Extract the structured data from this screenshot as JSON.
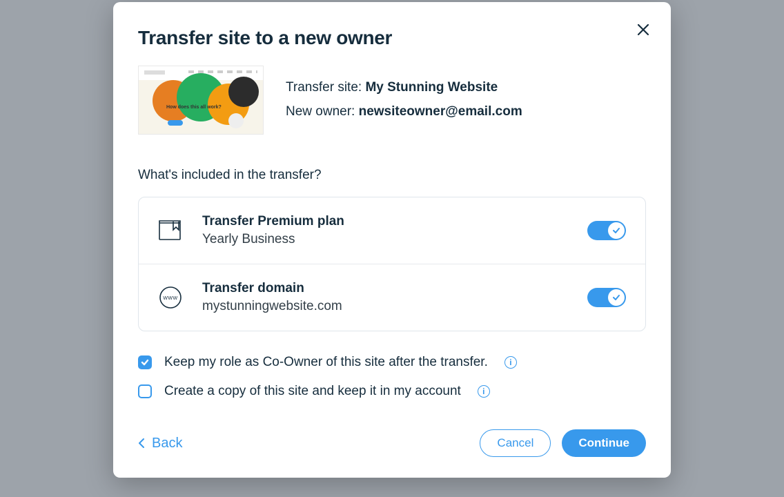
{
  "modal": {
    "title": "Transfer site to a new owner",
    "site": {
      "transfer_label": "Transfer site: ",
      "site_name": "My Stunning Website",
      "owner_label": "New owner: ",
      "owner_email": "newsiteowner@email.com",
      "thumb_text": "How does this all work?"
    },
    "included_label": "What's included in the transfer?",
    "items": [
      {
        "title": "Transfer Premium plan",
        "subtitle": "Yearly Business",
        "toggled": true,
        "icon": "plan"
      },
      {
        "title": "Transfer domain",
        "subtitle": "mystunningwebsite.com",
        "toggled": true,
        "icon": "www"
      }
    ],
    "options": [
      {
        "label": "Keep my role as Co-Owner of this site after the transfer.",
        "checked": true
      },
      {
        "label": "Create a copy of this site and keep it in my account",
        "checked": false
      }
    ],
    "footer": {
      "back": "Back",
      "cancel": "Cancel",
      "continue": "Continue"
    }
  }
}
